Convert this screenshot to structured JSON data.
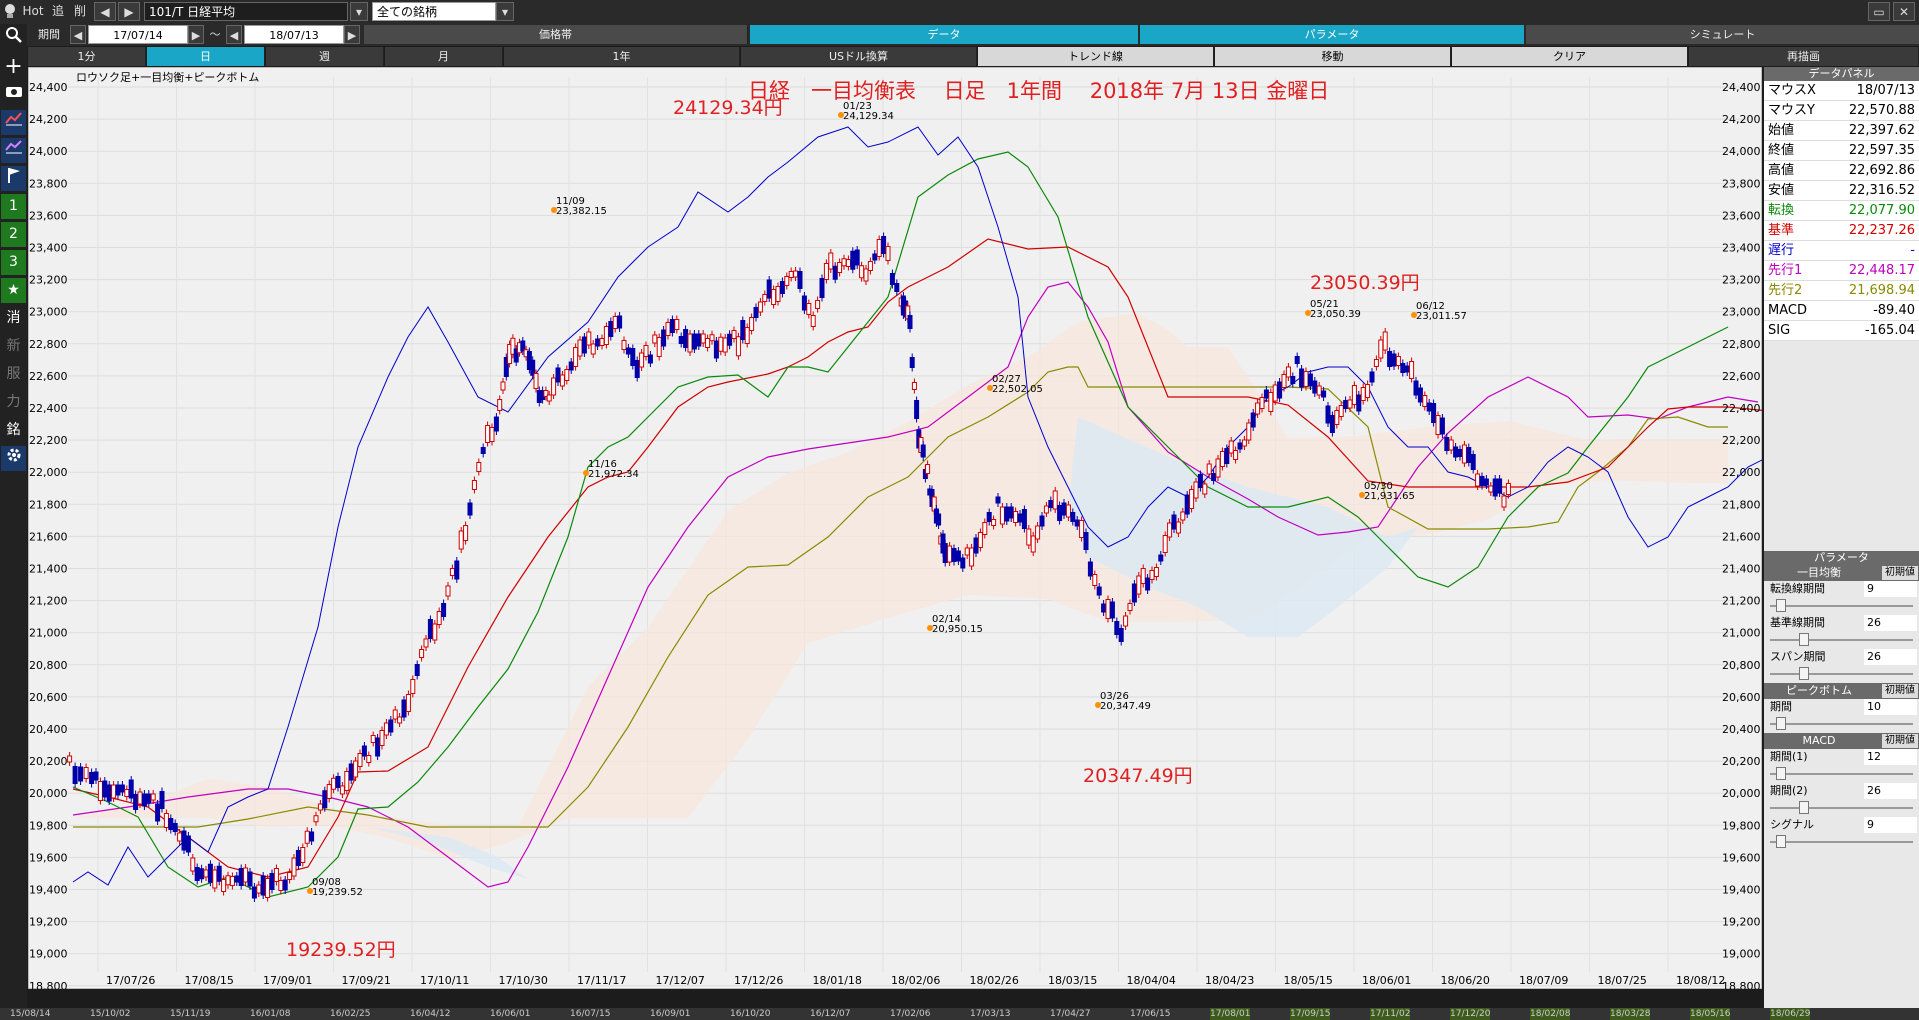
{
  "toolbar": {
    "hot": "Hot",
    "add": "追",
    "del": "削",
    "code": "101/T 日経平均",
    "market": "全ての銘柄",
    "period_label": "期間",
    "date_from": "17/07/14",
    "tilde": "～",
    "date_to": "18/07/13"
  },
  "tabs": {
    "price_band": "価格帯",
    "data": "データ",
    "parameter": "パラメータ",
    "simulate": "シミュレート"
  },
  "row3": {
    "b1": "1分",
    "b2": "日",
    "b3": "週",
    "b4": "月",
    "b5": "1年",
    "b6": "USドル換算",
    "b7": "トレンド線",
    "b8": "移動",
    "b9": "クリア",
    "b10": "再描画"
  },
  "sidebar": {
    "n1": "1",
    "n2": "2",
    "n3": "3",
    "k1": "消",
    "k2": "新",
    "k3": "服",
    "k4": "力",
    "k5": "銘"
  },
  "chart": {
    "legend": "ロウソク足+一目均衡+ピークボトム",
    "title": "日経　一目均衡表　 日足　1年間 　2018年 7月 13日 金曜日",
    "yticks": [
      "24,400",
      "24,200",
      "24,000",
      "23,800",
      "23,600",
      "23,400",
      "23,200",
      "23,000",
      "22,800",
      "22,600",
      "22,400",
      "22,200",
      "22,000",
      "21,800",
      "21,600",
      "21,400",
      "21,200",
      "21,000",
      "20,800",
      "20,600",
      "20,400",
      "20,200",
      "20,000",
      "19,800",
      "19,600",
      "19,400",
      "19,200",
      "19,000",
      "18,800"
    ],
    "xticks": [
      "17/07/26",
      "17/08/15",
      "17/09/01",
      "17/09/21",
      "17/10/11",
      "17/10/30",
      "17/11/17",
      "17/12/07",
      "17/12/26",
      "18/01/18",
      "18/02/06",
      "18/02/26",
      "18/03/15",
      "18/04/04",
      "18/04/23",
      "18/05/15",
      "18/06/01",
      "18/06/20",
      "18/07/09",
      "18/07/25",
      "18/08/12"
    ],
    "big_labels": {
      "top1": "24129.34円",
      "top2": "23050.39円",
      "low1": "20347.49円",
      "low2": "19239.52円"
    },
    "annotations": [
      {
        "d": "11/09",
        "v": "23,382.15"
      },
      {
        "d": "01/23",
        "v": "24,129.34"
      },
      {
        "d": "11/16",
        "v": "21,972.34"
      },
      {
        "d": "02/27",
        "v": "22,502.05"
      },
      {
        "d": "02/14",
        "v": "20,950.15"
      },
      {
        "d": "03/26",
        "v": "20,347.49"
      },
      {
        "d": "09/08",
        "v": "19,239.52"
      },
      {
        "d": "05/21",
        "v": "23,050.39"
      },
      {
        "d": "06/12",
        "v": "23,011.57"
      },
      {
        "d": "05/30",
        "v": "21,931.65"
      }
    ]
  },
  "panel": {
    "header": "データパネル",
    "rows": [
      {
        "k": "マウスX",
        "v": "18/07/13",
        "c": "#000"
      },
      {
        "k": "マウスY",
        "v": "22,570.88",
        "c": "#000"
      },
      {
        "k": "始値",
        "v": "22,397.62",
        "c": "#000"
      },
      {
        "k": "終値",
        "v": "22,597.35",
        "c": "#000"
      },
      {
        "k": "高値",
        "v": "22,692.86",
        "c": "#000"
      },
      {
        "k": "安値",
        "v": "22,316.52",
        "c": "#000"
      },
      {
        "k": "転換",
        "v": "22,077.90",
        "c": "#0a8a0a"
      },
      {
        "k": "基準",
        "v": "22,237.26",
        "c": "#d00000"
      },
      {
        "k": "遅行",
        "v": "-",
        "c": "#0000cc"
      },
      {
        "k": "先行1",
        "v": "22,448.17",
        "c": "#c000c0"
      },
      {
        "k": "先行2",
        "v": "21,698.94",
        "c": "#8a8a00"
      },
      {
        "k": "MACD",
        "v": "-89.40",
        "c": "#000"
      },
      {
        "k": "SIG",
        "v": "-165.04",
        "c": "#000"
      }
    ],
    "param_header": "パラメータ",
    "ichimoku": "一目均衡",
    "reset": "初期値",
    "tenkan_label": "転換線期間",
    "tenkan_val": "9",
    "kijun_label": "基準線期間",
    "kijun_val": "26",
    "span_label": "スパン期間",
    "span_val": "26",
    "peak": "ピークボトム",
    "peak_label": "期間",
    "peak_val": "10",
    "macd": "MACD",
    "p1_label": "期間(1)",
    "p1_val": "12",
    "p2_label": "期間(2)",
    "p2_val": "26",
    "sig_label": "シグナル",
    "sig_val": "9"
  },
  "bottom_dates": [
    "15/08/14",
    "15/10/02",
    "15/11/19",
    "16/01/08",
    "16/02/25",
    "16/04/12",
    "16/06/01",
    "16/07/15",
    "16/09/01",
    "16/10/20",
    "16/12/07",
    "17/02/06",
    "17/03/13",
    "17/04/27",
    "17/06/15",
    "17/08/01",
    "17/09/15",
    "17/11/02",
    "17/12/20",
    "18/02/08",
    "18/03/28",
    "18/05/16",
    "18/06/29"
  ]
}
